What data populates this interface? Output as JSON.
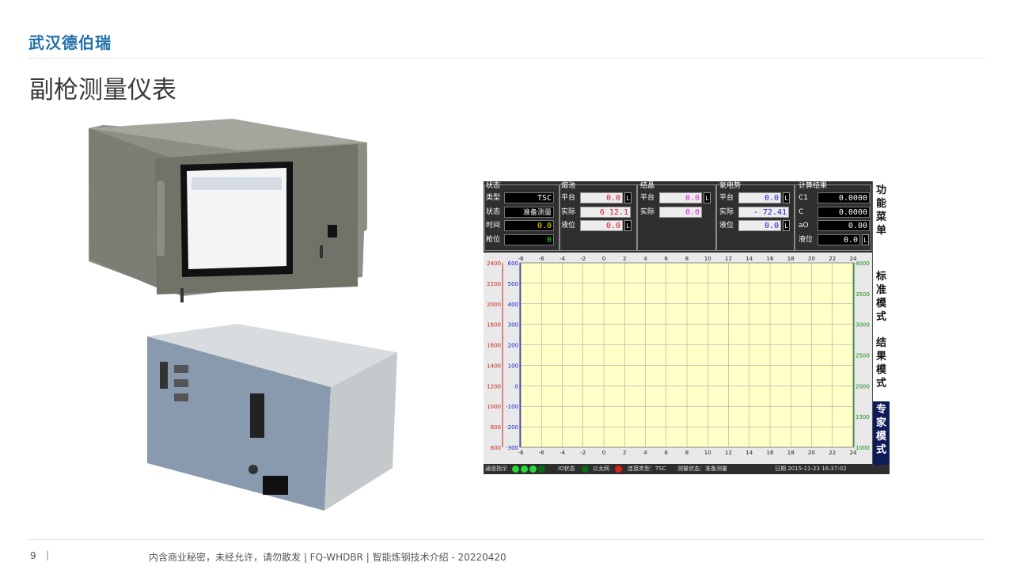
{
  "header": {
    "brand": "武汉德伯瑞",
    "title": "副枪测量仪表"
  },
  "footer": {
    "page_number": "9",
    "separator": "|",
    "text": "内含商业秘密，未经允许，请勿散发 | FQ-WHDBR | 智能炼钢技术介绍 - 20220420"
  },
  "meter": {
    "status": {
      "title": "状态",
      "type_label": "类型",
      "type_value": "TSC",
      "state_label": "状态",
      "state_value": "准备测量",
      "time_label": "时间",
      "time_value": "0.0",
      "gun_label": "枪位",
      "gun_value": "0"
    },
    "bath": {
      "title": "熔池",
      "platform_label": "平台",
      "platform_value": "0.0",
      "actual_label": "实际",
      "actual_value": "6 12.1",
      "level_label": "液位",
      "level_value": "0.0",
      "unit": "L"
    },
    "crystal": {
      "title": "结晶",
      "platform_label": "平台",
      "platform_value": "0.0",
      "actual_label": "实际",
      "actual_value": "0.0",
      "unit": "L"
    },
    "oxygen": {
      "title": "氧电势",
      "platform_label": "平台",
      "platform_value": "0.0",
      "actual_label": "实际",
      "actual_value": "- 72.41",
      "level_label": "液位",
      "level_value": "0.0",
      "unit": "L"
    },
    "calc": {
      "title": "计算结果",
      "c1_label": "C1",
      "c1_value": "0.0000",
      "c_label": "C",
      "c_value": "0.0000",
      "ao_label": "aO",
      "ao_value": "0.00",
      "level_label": "液位",
      "level_value": "0.0",
      "unit": "L"
    },
    "side_buttons": [
      {
        "chars": [
          "功",
          "能",
          "菜",
          "单"
        ]
      },
      {
        "chars": [
          "标",
          "准",
          "模",
          "式"
        ]
      },
      {
        "chars": [
          "结",
          "果",
          "模",
          "式"
        ]
      },
      {
        "chars": [
          "专",
          "家",
          "模",
          "式"
        ]
      }
    ],
    "status_bar": {
      "channel": "通道指示",
      "io": "IO状态",
      "ethernet": "以太网",
      "connect": "连接类型：TSC",
      "measure": "测量状态：准备测量",
      "date": "日期 2015-11-23 16:37:02"
    },
    "colors": {
      "left_axis_outer": "#d02020",
      "left_axis_inner": "#1a1ad0",
      "right_axis": "#1a8a1a",
      "plot_bg": "#ffffc8",
      "grid": "#9a9a9a"
    }
  },
  "chart_data": {
    "type": "line",
    "title": "",
    "xlabel": "",
    "ylabel": "",
    "x_ticks": [
      "-8",
      "-6",
      "-4",
      "-2",
      "0",
      "2",
      "4",
      "6",
      "8",
      "10",
      "12",
      "14",
      "16",
      "18",
      "20",
      "22",
      "24"
    ],
    "xlim": [
      -8,
      24
    ],
    "left_axis_outer": {
      "ticks": [
        "2400",
        "2200",
        "2000",
        "1800",
        "1600",
        "1400",
        "1200",
        "1000",
        "800",
        "600"
      ],
      "ylim": [
        600,
        2400
      ]
    },
    "left_axis_inner": {
      "ticks": [
        "600",
        "500",
        "400",
        "300",
        "200",
        "100",
        "0",
        "-100",
        "-200",
        "-300"
      ],
      "ylim": [
        -300,
        600
      ]
    },
    "right_axis": {
      "ticks": [
        "4000",
        "3500",
        "3000",
        "2500",
        "2000",
        "1500",
        "1000"
      ],
      "ylim": [
        1000,
        4000
      ]
    },
    "grid": true,
    "series": []
  }
}
